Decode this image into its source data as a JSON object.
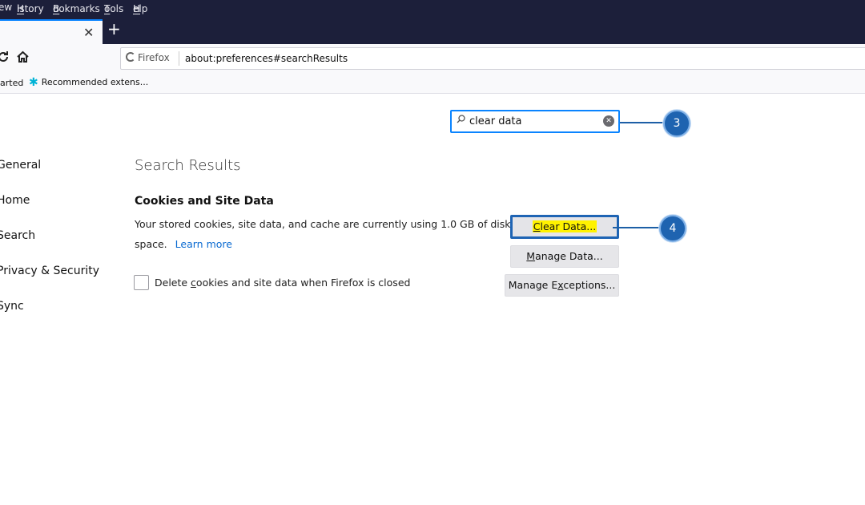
{
  "menu": [
    {
      "label": "ew",
      "underline": ""
    },
    {
      "label": "History",
      "underline": "H"
    },
    {
      "label": "Bookmarks",
      "underline": "B"
    },
    {
      "label": "Tools",
      "underline": "T"
    },
    {
      "label": "Help",
      "underline": "H"
    }
  ],
  "tabs": {
    "close_glyph": "✕",
    "new_tab_glyph": "+"
  },
  "navbar": {
    "identity_label": "Firefox",
    "url": "about:preferences#searchResults",
    "reload_icon": "reload-icon",
    "home_icon": "home-icon"
  },
  "bookmarks": [
    {
      "label": "arted"
    },
    {
      "label": "Recommended extens...",
      "icon": "puzzle-icon"
    }
  ],
  "search": {
    "value": "clear data",
    "placeholder": ""
  },
  "sidebar": {
    "items": [
      {
        "label": "General"
      },
      {
        "label": "Home"
      },
      {
        "label": "Search"
      },
      {
        "label": "Privacy & Security"
      },
      {
        "label": "Sync"
      }
    ]
  },
  "results": {
    "title": "Search Results",
    "section_title": "Cookies and Site Data",
    "description_line1": "Your stored cookies, site data, and cache are currently using 1.0 GB of disk",
    "description_line2": "space.",
    "learn_more": "Learn more",
    "checkbox_pre": "Delete ",
    "checkbox_u": "c",
    "checkbox_post": "ookies and site data when Firefox is closed",
    "checkbox_checked": false
  },
  "buttons": {
    "clear_u": "C",
    "clear_rest": "lear Data...",
    "manage_u": "M",
    "manage_rest": "anage Data...",
    "exceptions_pre": "Manage E",
    "exceptions_u": "x",
    "exceptions_post": "ceptions..."
  },
  "callouts": [
    {
      "number": "3"
    },
    {
      "number": "4"
    }
  ],
  "colors": {
    "chrome_dark": "#1c1f3a",
    "accent": "#0a84ff",
    "callout": "#1e63b0",
    "highlight": "#fff200",
    "link": "#0a6ad1"
  }
}
